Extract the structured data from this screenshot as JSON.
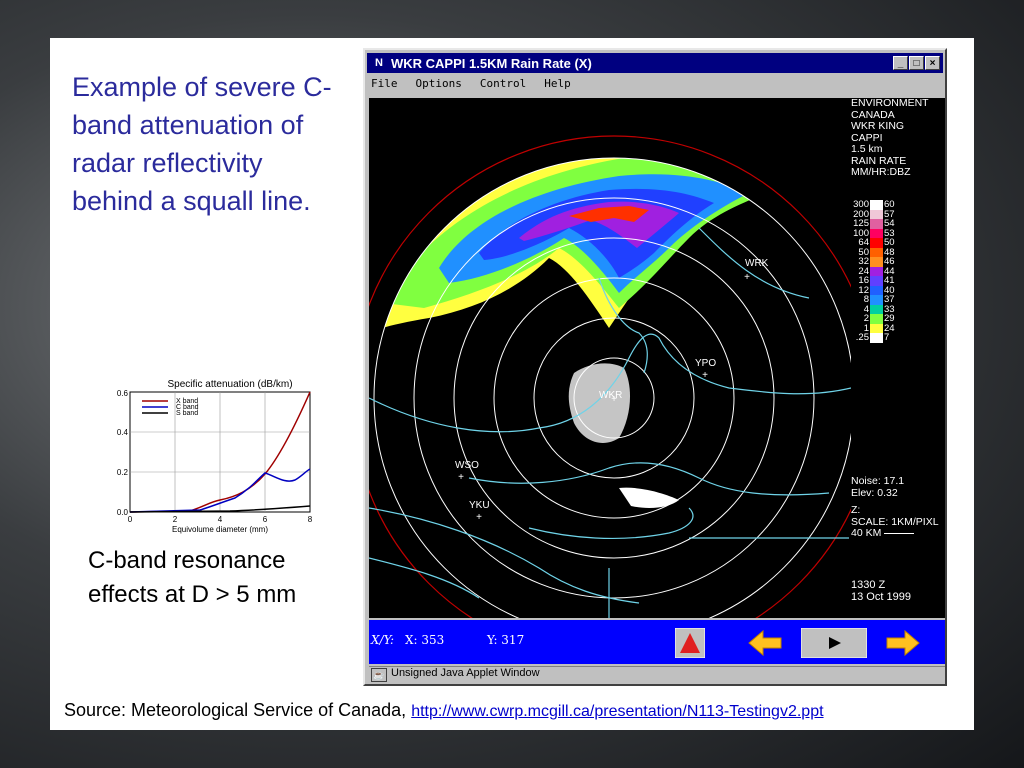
{
  "slide": {
    "heading": "Example of severe C-band attenuation of radar reflectivity behind a squall line.",
    "resonance_note": "C-band resonance effects at D > 5 mm",
    "source_label": "Source: Meteorological Service of Canada,",
    "source_link": "http://www.cwrp.mcgill.ca/presentation/N113-Testingv2.ppt"
  },
  "window": {
    "title": "WKR CAPPI 1.5KM Rain Rate (X)",
    "app_icon": "N",
    "controls": [
      "_",
      "□",
      "×"
    ],
    "menu": [
      "File",
      "Options",
      "Control",
      "Help"
    ],
    "status_text": "Unsigned Java Applet Window"
  },
  "radar": {
    "stations": [
      "WRK",
      "YPO",
      "WSO",
      "YKU",
      "WKR"
    ],
    "side_top": [
      "ENVIRONMENT",
      "CANADA",
      "WKR  KING",
      "CAPPI",
      "1.5 km",
      "RAIN RATE",
      "MM/HR:DBZ"
    ],
    "legend": [
      {
        "rate": "300",
        "dbz": "60",
        "color": "#ffffff"
      },
      {
        "rate": "200",
        "dbz": "57",
        "color": "#f0c8d8"
      },
      {
        "rate": "125",
        "dbz": "54",
        "color": "#e060a0"
      },
      {
        "rate": "100",
        "dbz": "53",
        "color": "#ff0060"
      },
      {
        "rate": "64",
        "dbz": "50",
        "color": "#ff0000"
      },
      {
        "rate": "50",
        "dbz": "48",
        "color": "#ff6000"
      },
      {
        "rate": "32",
        "dbz": "46",
        "color": "#ff9020"
      },
      {
        "rate": "24",
        "dbz": "44",
        "color": "#a020e0"
      },
      {
        "rate": "16",
        "dbz": "41",
        "color": "#6040ff"
      },
      {
        "rate": "12",
        "dbz": "40",
        "color": "#2060ff"
      },
      {
        "rate": "8",
        "dbz": "37",
        "color": "#2090ff"
      },
      {
        "rate": "4",
        "dbz": "33",
        "color": "#00d0a0"
      },
      {
        "rate": "2",
        "dbz": "29",
        "color": "#80ff40"
      },
      {
        "rate": "1",
        "dbz": "24",
        "color": "#ffff40"
      },
      {
        "rate": ".25",
        "dbz": "7",
        "color": "#ffffff"
      }
    ],
    "noise": "Noise:  17.1",
    "elev": "Elev:  0.32",
    "z": "Z:",
    "scale": "SCALE: 1KM/PIXL",
    "km": "40 KM",
    "time": "1330 Z",
    "date": "13 Oct 1999"
  },
  "controls_bar": {
    "xy_label": "X/Y:",
    "x": "X: 353",
    "y": "Y: 317"
  },
  "graph": {
    "title": "Specific attenuation (dB/km)",
    "xlabel": "Equivolume diameter (mm)",
    "legend": [
      "X band",
      "C band",
      "S band"
    ],
    "yticks": [
      "0.6",
      "0.4",
      "0.2",
      "0.0"
    ],
    "xticks": [
      "0",
      "2",
      "4",
      "6",
      "8"
    ]
  },
  "colors": {
    "heading": "#2b2b9c",
    "titlebar": "#000080",
    "bluebar": "#0000ff",
    "rings": "#ffffff",
    "coast": "#6fd3e8",
    "boundary": "#c00000"
  }
}
